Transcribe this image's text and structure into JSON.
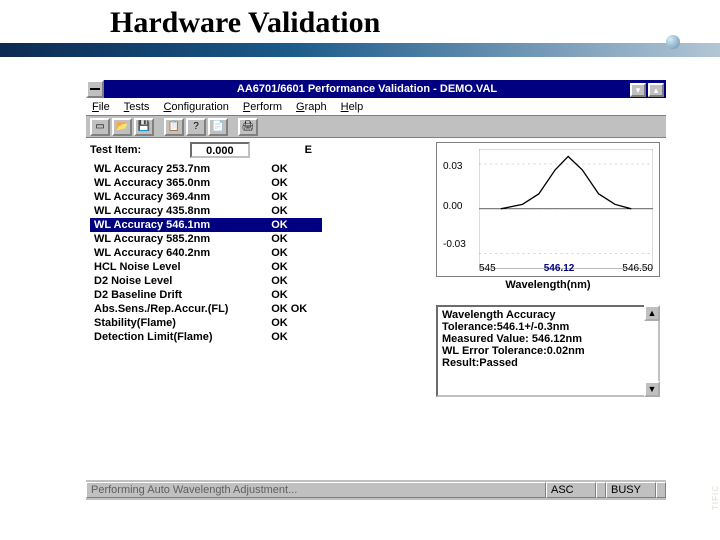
{
  "slide": {
    "title": "Hardware Validation"
  },
  "window": {
    "title": "AA6701/6601 Performance Validation - DEMO.VAL",
    "minimize_glyph": "▾",
    "maximize_glyph": "▴"
  },
  "menu": {
    "file": "File",
    "tests": "Tests",
    "configuration": "Configuration",
    "perform": "Perform",
    "graph": "Graph",
    "help": "Help"
  },
  "toolbar": {
    "new": "new-icon",
    "open": "open-icon",
    "save": "save-icon",
    "copy": "copy-icon",
    "help": "help-icon",
    "report": "report-icon",
    "print": "print-icon"
  },
  "left": {
    "test_item_label": "Test Item:",
    "value_box": "0.000",
    "e_label": "E"
  },
  "tests": [
    {
      "name": "WL Accuracy 253.7nm",
      "status": "OK",
      "selected": false
    },
    {
      "name": "WL Accuracy 365.0nm",
      "status": "OK",
      "selected": false
    },
    {
      "name": "WL Accuracy 369.4nm",
      "status": "OK",
      "selected": false
    },
    {
      "name": "WL Accuracy 435.8nm",
      "status": "OK",
      "selected": false
    },
    {
      "name": "WL Accuracy 546.1nm",
      "status": "OK",
      "selected": true
    },
    {
      "name": "WL Accuracy 585.2nm",
      "status": "OK",
      "selected": false
    },
    {
      "name": "WL Accuracy 640.2nm",
      "status": "OK",
      "selected": false
    },
    {
      "name": "HCL Noise Level",
      "status": "OK",
      "selected": false
    },
    {
      "name": "D2 Noise Level",
      "status": "OK",
      "selected": false
    },
    {
      "name": "D2 Baseline Drift",
      "status": "OK",
      "selected": false
    },
    {
      "name": "Abs.Sens./Rep.Accur.(FL)",
      "status": "OK OK",
      "selected": false
    },
    {
      "name": "Stability(Flame)",
      "status": "OK",
      "selected": false
    },
    {
      "name": "Detection Limit(Flame)",
      "status": "OK",
      "selected": false
    }
  ],
  "chart_data": {
    "type": "line",
    "title": "",
    "xlabel": "Wavelength(nm)",
    "ylabel": "",
    "x": [
      545.5,
      545.7,
      545.85,
      546.0,
      546.12,
      546.25,
      546.4,
      546.55,
      546.7
    ],
    "values": [
      0.0,
      0.003,
      0.01,
      0.026,
      0.035,
      0.026,
      0.01,
      0.003,
      0.0
    ],
    "yticks": [
      -0.03,
      0.0,
      0.03
    ],
    "xticks_labels": [
      "545",
      "546.12",
      "546.50"
    ],
    "xlim": [
      545.3,
      546.9
    ],
    "ylim": [
      -0.04,
      0.04
    ]
  },
  "details": {
    "line1": "Wavelength Accuracy",
    "line2": "Tolerance:546.1+/-0.3nm",
    "line3": "Measured Value: 546.12nm",
    "line4": "WL Error Tolerance:0.02nm",
    "line5": "Result:Passed"
  },
  "statusbar": {
    "main": "Performing Auto Wavelength Adjustment...",
    "asc": "ASC",
    "busy": "BUSY"
  },
  "watermark": "TIFIC"
}
